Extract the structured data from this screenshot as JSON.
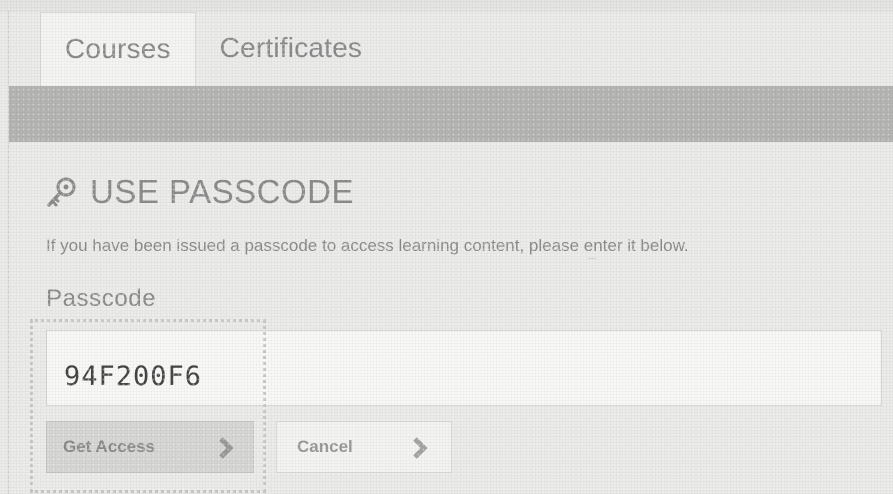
{
  "tabs": [
    {
      "label": "Courses",
      "active": true
    },
    {
      "label": "Certificates",
      "active": false
    }
  ],
  "section": {
    "title": "USE PASSCODE",
    "icon": "key-icon",
    "instructions": "If you have been issued a passcode to access learning content, please enter it below."
  },
  "form": {
    "passcode_label": "Passcode",
    "passcode_value": "94F200F6"
  },
  "buttons": {
    "get_access": "Get Access",
    "cancel": "Cancel",
    "chevron_icon": "chevron-right-icon"
  },
  "colors": {
    "band": "#b4b4b2",
    "text": "#8c8c8c"
  }
}
